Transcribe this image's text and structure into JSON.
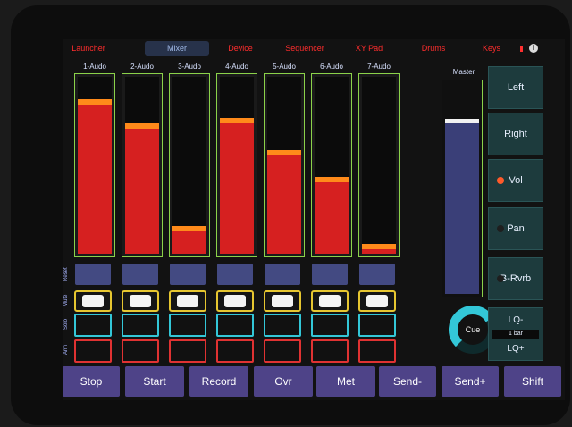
{
  "tabs": [
    {
      "label": "Launcher",
      "active": false
    },
    {
      "label": "Mixer",
      "active": true
    },
    {
      "label": "Device",
      "active": false
    },
    {
      "label": "Sequencer",
      "active": false
    },
    {
      "label": "XY Pad",
      "active": false
    },
    {
      "label": "Drums",
      "active": false
    },
    {
      "label": "Keys",
      "active": false
    }
  ],
  "channels": [
    {
      "name": "1-Audo",
      "level": 0.86
    },
    {
      "name": "2-Audo",
      "level": 0.72
    },
    {
      "name": "3-Audo",
      "level": 0.14
    },
    {
      "name": "4-Audo",
      "level": 0.75
    },
    {
      "name": "5-Audo",
      "level": 0.57
    },
    {
      "name": "6-Audo",
      "level": 0.42
    },
    {
      "name": "7-Audo",
      "level": 0.04
    }
  ],
  "row_labels": {
    "reset": "Reset",
    "mute": "Mute",
    "solo": "Solo",
    "arm": "Arm"
  },
  "master": {
    "label": "Master",
    "level": 0.83
  },
  "cue": {
    "label": "Cue",
    "value": 0.72
  },
  "right_panel": {
    "buttons": [
      {
        "label": "Left",
        "led": null
      },
      {
        "label": "Right",
        "led": null
      },
      {
        "label": "Vol",
        "led": "on"
      },
      {
        "label": "Pan",
        "led": "off"
      },
      {
        "label": "B-Rvrb",
        "led": "off"
      }
    ],
    "lq_minus": "LQ-",
    "lq_value": "1 bar",
    "lq_plus": "LQ+"
  },
  "transport": [
    "Stop",
    "Start",
    "Record",
    "Ovr",
    "Met",
    "Send-",
    "Send+",
    "Shift"
  ],
  "colors": {
    "tab_text": "#ff2d2d",
    "fader_fill": "#d62020",
    "fader_knob": "#ff8a1a",
    "fader_border": "#8bd24a",
    "mute": "#e6c630",
    "solo": "#33c7d8",
    "arm": "#e03232",
    "led_on": "#ff5a2a",
    "led_off": "#1e1e1e",
    "cue_ring": "#33c7d8"
  }
}
